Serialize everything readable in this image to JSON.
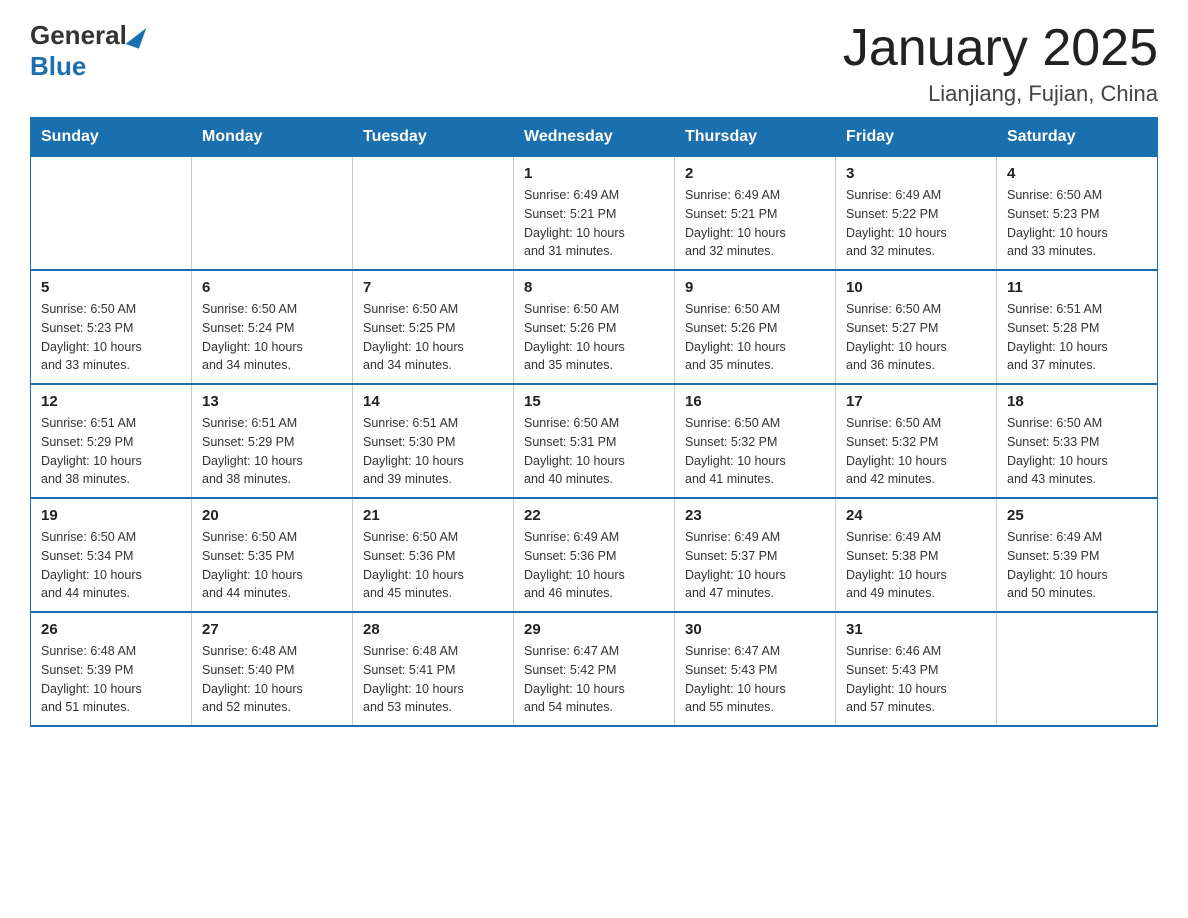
{
  "header": {
    "logo_general": "General",
    "logo_blue": "Blue",
    "month_title": "January 2025",
    "location": "Lianjiang, Fujian, China"
  },
  "days_of_week": [
    "Sunday",
    "Monday",
    "Tuesday",
    "Wednesday",
    "Thursday",
    "Friday",
    "Saturday"
  ],
  "weeks": [
    [
      {
        "day": "",
        "info": ""
      },
      {
        "day": "",
        "info": ""
      },
      {
        "day": "",
        "info": ""
      },
      {
        "day": "1",
        "info": "Sunrise: 6:49 AM\nSunset: 5:21 PM\nDaylight: 10 hours\nand 31 minutes."
      },
      {
        "day": "2",
        "info": "Sunrise: 6:49 AM\nSunset: 5:21 PM\nDaylight: 10 hours\nand 32 minutes."
      },
      {
        "day": "3",
        "info": "Sunrise: 6:49 AM\nSunset: 5:22 PM\nDaylight: 10 hours\nand 32 minutes."
      },
      {
        "day": "4",
        "info": "Sunrise: 6:50 AM\nSunset: 5:23 PM\nDaylight: 10 hours\nand 33 minutes."
      }
    ],
    [
      {
        "day": "5",
        "info": "Sunrise: 6:50 AM\nSunset: 5:23 PM\nDaylight: 10 hours\nand 33 minutes."
      },
      {
        "day": "6",
        "info": "Sunrise: 6:50 AM\nSunset: 5:24 PM\nDaylight: 10 hours\nand 34 minutes."
      },
      {
        "day": "7",
        "info": "Sunrise: 6:50 AM\nSunset: 5:25 PM\nDaylight: 10 hours\nand 34 minutes."
      },
      {
        "day": "8",
        "info": "Sunrise: 6:50 AM\nSunset: 5:26 PM\nDaylight: 10 hours\nand 35 minutes."
      },
      {
        "day": "9",
        "info": "Sunrise: 6:50 AM\nSunset: 5:26 PM\nDaylight: 10 hours\nand 35 minutes."
      },
      {
        "day": "10",
        "info": "Sunrise: 6:50 AM\nSunset: 5:27 PM\nDaylight: 10 hours\nand 36 minutes."
      },
      {
        "day": "11",
        "info": "Sunrise: 6:51 AM\nSunset: 5:28 PM\nDaylight: 10 hours\nand 37 minutes."
      }
    ],
    [
      {
        "day": "12",
        "info": "Sunrise: 6:51 AM\nSunset: 5:29 PM\nDaylight: 10 hours\nand 38 minutes."
      },
      {
        "day": "13",
        "info": "Sunrise: 6:51 AM\nSunset: 5:29 PM\nDaylight: 10 hours\nand 38 minutes."
      },
      {
        "day": "14",
        "info": "Sunrise: 6:51 AM\nSunset: 5:30 PM\nDaylight: 10 hours\nand 39 minutes."
      },
      {
        "day": "15",
        "info": "Sunrise: 6:50 AM\nSunset: 5:31 PM\nDaylight: 10 hours\nand 40 minutes."
      },
      {
        "day": "16",
        "info": "Sunrise: 6:50 AM\nSunset: 5:32 PM\nDaylight: 10 hours\nand 41 minutes."
      },
      {
        "day": "17",
        "info": "Sunrise: 6:50 AM\nSunset: 5:32 PM\nDaylight: 10 hours\nand 42 minutes."
      },
      {
        "day": "18",
        "info": "Sunrise: 6:50 AM\nSunset: 5:33 PM\nDaylight: 10 hours\nand 43 minutes."
      }
    ],
    [
      {
        "day": "19",
        "info": "Sunrise: 6:50 AM\nSunset: 5:34 PM\nDaylight: 10 hours\nand 44 minutes."
      },
      {
        "day": "20",
        "info": "Sunrise: 6:50 AM\nSunset: 5:35 PM\nDaylight: 10 hours\nand 44 minutes."
      },
      {
        "day": "21",
        "info": "Sunrise: 6:50 AM\nSunset: 5:36 PM\nDaylight: 10 hours\nand 45 minutes."
      },
      {
        "day": "22",
        "info": "Sunrise: 6:49 AM\nSunset: 5:36 PM\nDaylight: 10 hours\nand 46 minutes."
      },
      {
        "day": "23",
        "info": "Sunrise: 6:49 AM\nSunset: 5:37 PM\nDaylight: 10 hours\nand 47 minutes."
      },
      {
        "day": "24",
        "info": "Sunrise: 6:49 AM\nSunset: 5:38 PM\nDaylight: 10 hours\nand 49 minutes."
      },
      {
        "day": "25",
        "info": "Sunrise: 6:49 AM\nSunset: 5:39 PM\nDaylight: 10 hours\nand 50 minutes."
      }
    ],
    [
      {
        "day": "26",
        "info": "Sunrise: 6:48 AM\nSunset: 5:39 PM\nDaylight: 10 hours\nand 51 minutes."
      },
      {
        "day": "27",
        "info": "Sunrise: 6:48 AM\nSunset: 5:40 PM\nDaylight: 10 hours\nand 52 minutes."
      },
      {
        "day": "28",
        "info": "Sunrise: 6:48 AM\nSunset: 5:41 PM\nDaylight: 10 hours\nand 53 minutes."
      },
      {
        "day": "29",
        "info": "Sunrise: 6:47 AM\nSunset: 5:42 PM\nDaylight: 10 hours\nand 54 minutes."
      },
      {
        "day": "30",
        "info": "Sunrise: 6:47 AM\nSunset: 5:43 PM\nDaylight: 10 hours\nand 55 minutes."
      },
      {
        "day": "31",
        "info": "Sunrise: 6:46 AM\nSunset: 5:43 PM\nDaylight: 10 hours\nand 57 minutes."
      },
      {
        "day": "",
        "info": ""
      }
    ]
  ]
}
